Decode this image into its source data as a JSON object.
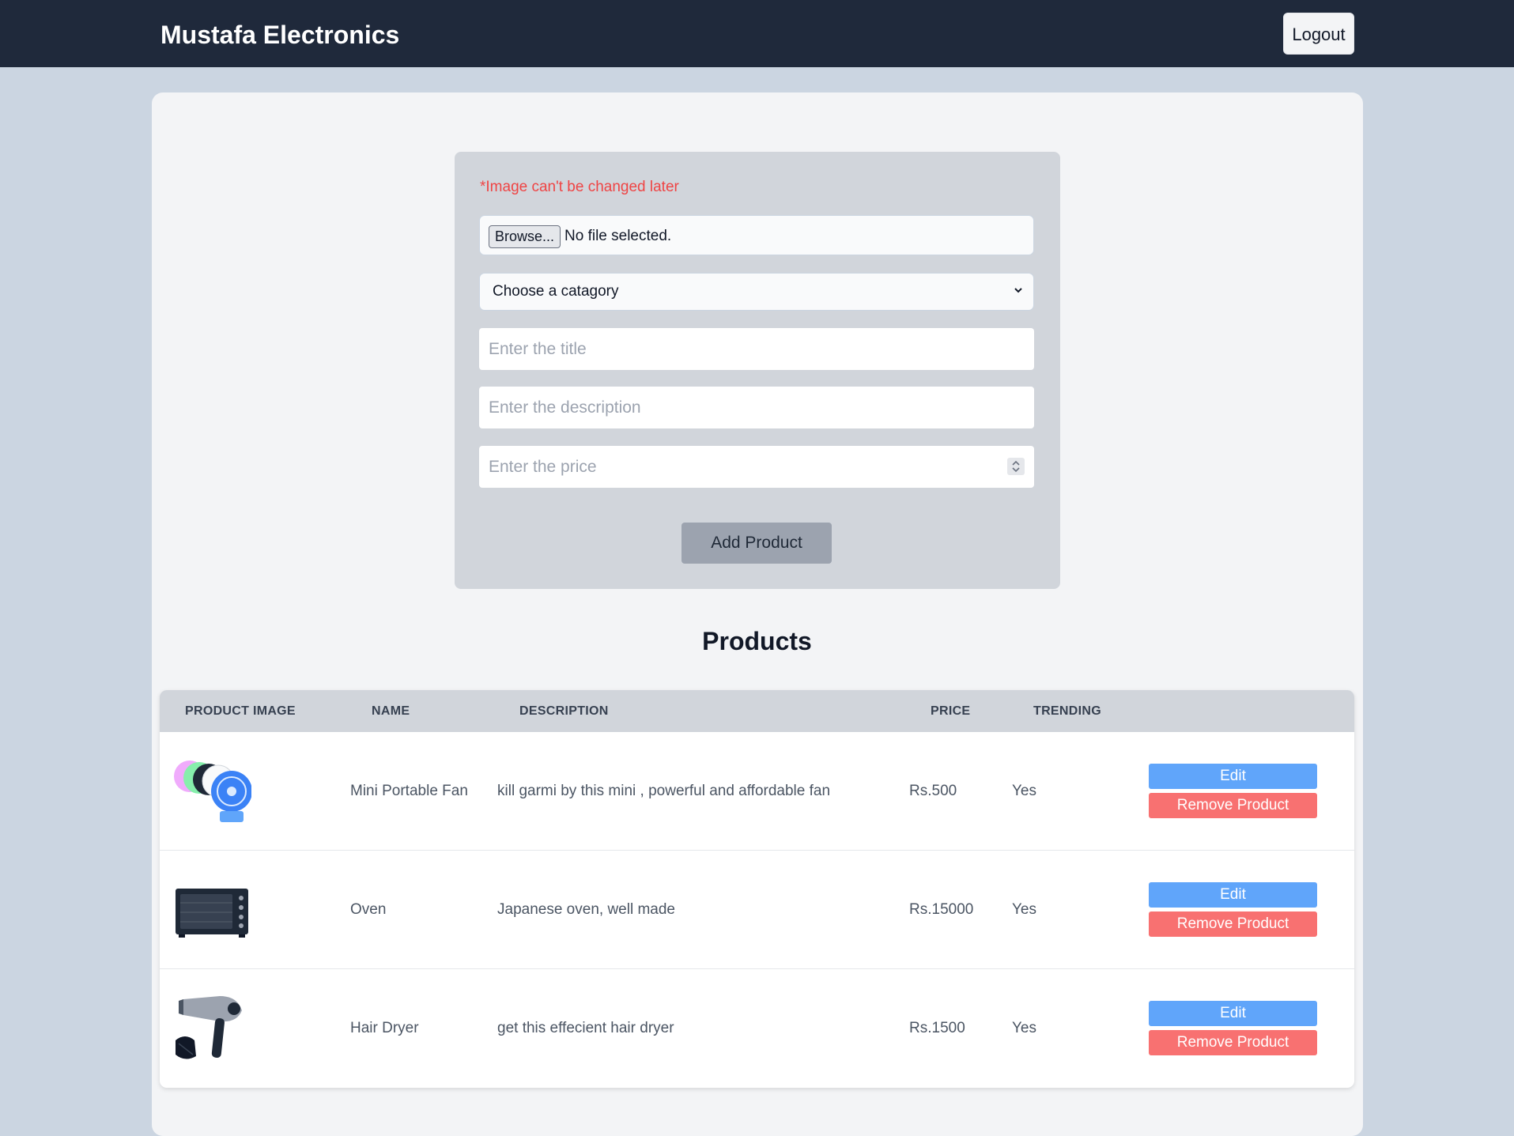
{
  "navbar": {
    "brand": "Mustafa Electronics",
    "logout_label": "Logout"
  },
  "form": {
    "warning": "*Image can't be changed later",
    "file_button_label": "Browse...",
    "file_status": "No file selected.",
    "category_selected": "Choose a catagory",
    "title_placeholder": "Enter the title",
    "description_placeholder": "Enter the description",
    "price_placeholder": "Enter the price",
    "submit_label": "Add Product"
  },
  "products": {
    "heading": "Products",
    "columns": [
      "PRODUCT IMAGE",
      "NAME",
      "DESCRIPTION",
      "PRICE",
      "TRENDING"
    ],
    "edit_label": "Edit",
    "remove_label": "Remove Product",
    "rows": [
      {
        "image_icon": "mini-fan-image",
        "name": "Mini Portable Fan",
        "description": "kill garmi by this mini , powerful and affordable fan",
        "price": "Rs.500",
        "trending": "Yes"
      },
      {
        "image_icon": "oven-image",
        "name": "Oven",
        "description": "Japanese oven, well made",
        "price": "Rs.15000",
        "trending": "Yes"
      },
      {
        "image_icon": "hair-dryer-image",
        "name": "Hair Dryer",
        "description": "get this effecient hair dryer",
        "price": "Rs.1500",
        "trending": "Yes"
      }
    ]
  },
  "colors": {
    "navbar": "#1f293b",
    "page_background": "#cbd5e1",
    "card_background": "#f3f4f6",
    "form_background": "#d1d5db",
    "warning": "#ef4444",
    "edit_button": "#60a5fa",
    "remove_button": "#f87171"
  }
}
